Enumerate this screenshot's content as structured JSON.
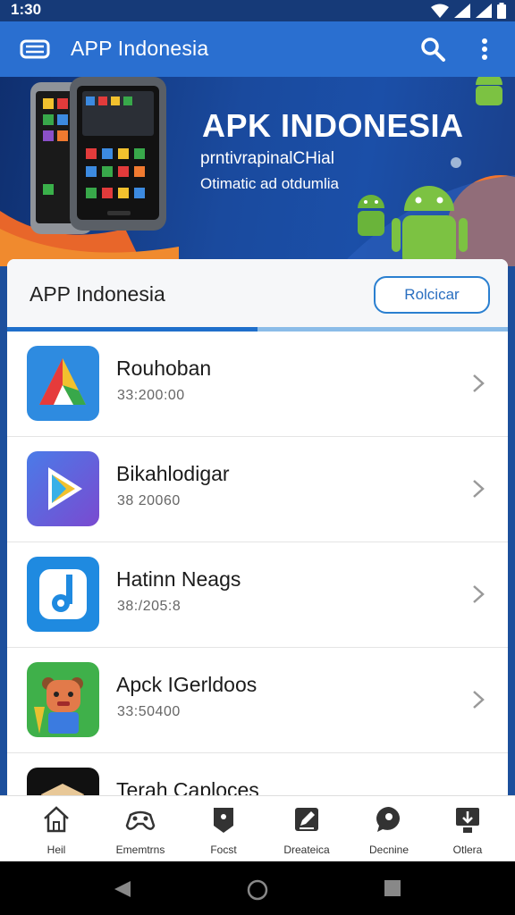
{
  "status_bar": {
    "time": "1:30"
  },
  "app_bar": {
    "title": "APP Indonesia"
  },
  "banner": {
    "title": "APK INDONESIA",
    "subtitle_line1": "prntivrapinalCHial",
    "subtitle_line2": "Otimatic ad otdumlia"
  },
  "list_header": {
    "title": "APP Indonesia",
    "button_label": "Rolcicar",
    "progress": 0.5
  },
  "apps": [
    {
      "name": "Rouhoban",
      "subtitle": "33:200:00",
      "icon": "triangle-app-icon"
    },
    {
      "name": "Bikahlodigar",
      "subtitle": "38 20060",
      "icon": "play-app-icon"
    },
    {
      "name": "Hatinn Neags",
      "subtitle": "38:/205:8",
      "icon": "music-app-icon"
    },
    {
      "name": "Apck IGerldoos",
      "subtitle": "33:50400",
      "icon": "game-app-icon"
    },
    {
      "name": "Terah Caploces",
      "subtitle": "",
      "icon": "box-app-icon"
    }
  ],
  "bottom_nav": [
    {
      "label": "Heil",
      "icon": "home-icon"
    },
    {
      "label": "Ememtrns",
      "icon": "controller-icon"
    },
    {
      "label": "Focst",
      "icon": "tag-icon"
    },
    {
      "label": "Dreateica",
      "icon": "edit-icon"
    },
    {
      "label": "Decnine",
      "icon": "chat-icon"
    },
    {
      "label": "Otlera",
      "icon": "download-icon"
    }
  ],
  "colors": {
    "app_bar": "#2a6fd0",
    "status_bar": "#163a78",
    "accent": "#2a7fd0",
    "banner": "#1a4a9e"
  }
}
